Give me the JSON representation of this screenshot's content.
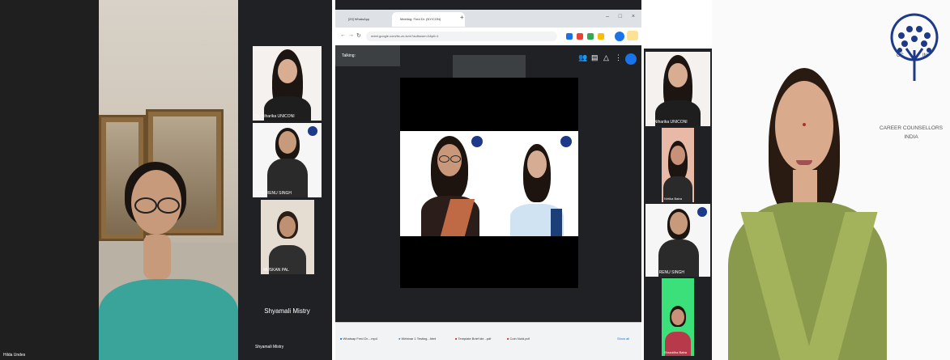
{
  "panel1": {
    "tiles": [
      {
        "label": "Dr. Niharika UNICONI"
      },
      {
        "label": "CCIN RENU SINGH"
      },
      {
        "label": "MUSKAN PAL"
      },
      {
        "label": "Shyamali Mistry",
        "center_text": "Shyamali Mistry"
      }
    ],
    "main_label": "Hilda Undes"
  },
  "panel2": {
    "tabs": [
      {
        "label": "[29] WhatsApp"
      },
      {
        "label": "Meeting: Fred Dr. (NY/CON)"
      }
    ],
    "url": "meet.google.com/tix-zn-kvm?authuser=0&pli=1",
    "talking_label": "Talking:",
    "downloads": [
      {
        "label": "Whatsap Fred Dr....mp4"
      },
      {
        "label": "Webinar 1 Testing...html"
      },
      {
        "label": "Template Brief ide...pdf"
      },
      {
        "label": "Coin Nold.pdf"
      }
    ],
    "show_all": "Show all"
  },
  "panel3": {
    "tiles": [
      {
        "label": "Dr. Niharika UNICONI"
      },
      {
        "label": "Nirtika Batra"
      },
      {
        "label": "CCIN RENU SINGH"
      },
      {
        "label": "Shraddha Batra"
      }
    ],
    "logo_line1": "CAREER COUNSELLORS",
    "logo_line2": "INDIA",
    "logo_mark_left": "CC",
    "logo_mark_right": "IN"
  },
  "colors": {
    "meet_bg": "#202124",
    "logo_blue": "#1d3a8a"
  }
}
